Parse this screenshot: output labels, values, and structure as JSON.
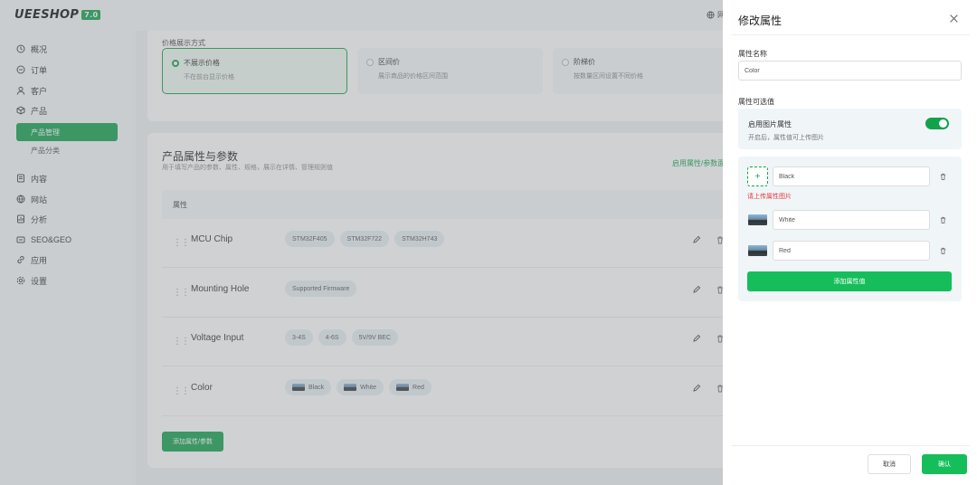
{
  "app": {
    "logo": "UEESHOP",
    "version": "7.0",
    "top_right_text": "网"
  },
  "sidebar": {
    "items": [
      {
        "label": "概况",
        "icon": "clock-icon"
      },
      {
        "label": "订单",
        "icon": "order-icon"
      },
      {
        "label": "客户",
        "icon": "user-icon"
      },
      {
        "label": "产品",
        "icon": "cube-icon"
      }
    ],
    "sub_items": [
      {
        "label": "产品管理",
        "active": true
      },
      {
        "label": "产品分类",
        "active": false
      }
    ],
    "items2": [
      {
        "label": "内容",
        "icon": "document-icon"
      },
      {
        "label": "网站",
        "icon": "globe-icon"
      },
      {
        "label": "分析",
        "icon": "chart-icon"
      },
      {
        "label": "SEO&GEO",
        "icon": "seo-icon"
      },
      {
        "label": "应用",
        "icon": "link-icon"
      },
      {
        "label": "设置",
        "icon": "gear-icon"
      }
    ]
  },
  "price": {
    "label": "价格展示方式",
    "options": [
      {
        "title": "不展示价格",
        "desc": "不在前台显示价格",
        "selected": true
      },
      {
        "title": "区间价",
        "desc": "展示商品的价格区间范围",
        "selected": false
      },
      {
        "title": "阶梯价",
        "desc": "按数量区间设置不同价格",
        "selected": false
      }
    ]
  },
  "attrs": {
    "title": "产品属性与参数",
    "subtitle": "用于填写产品的参数、属性、规格，展示在详情、管理规则值",
    "link": "启用属性/参数面",
    "col_header": "属性",
    "rows": [
      {
        "name": "MCU Chip",
        "values": [
          "STM32F405",
          "STM32F722",
          "STM32H743"
        ],
        "images": false
      },
      {
        "name": "Mounting Hole",
        "values": [
          "Supported Firmware"
        ],
        "images": false
      },
      {
        "name": "Voltage Input",
        "values": [
          "3-4S",
          "4-6S",
          "5V/9V BEC"
        ],
        "images": false
      },
      {
        "name": "Color",
        "values": [
          "Black",
          "White",
          "Red"
        ],
        "images": true
      }
    ],
    "add_button": "添加属性/参数"
  },
  "drawer": {
    "title": "修改属性",
    "name_label": "属性名称",
    "name_value": "Color",
    "values_label": "属性可选值",
    "image_attr": {
      "title": "启用图片属性",
      "desc": "开启后，属性值可上传图片",
      "enabled": true
    },
    "values": [
      {
        "value": "Black",
        "has_image": false
      },
      {
        "value": "White",
        "has_image": true
      },
      {
        "value": "Red",
        "has_image": true
      }
    ],
    "error": "请上传属性图片",
    "add_value": "添加属性值",
    "cancel": "取消",
    "confirm": "确认"
  },
  "colors": {
    "accent": "#13a24c",
    "accent_light": "#15be5a",
    "error": "#e23b3b"
  }
}
